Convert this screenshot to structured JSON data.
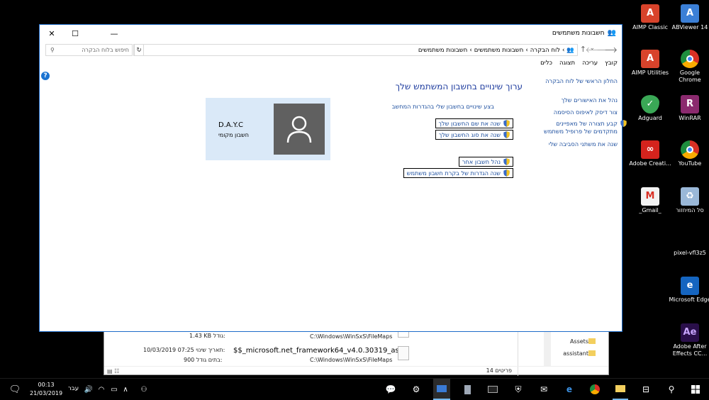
{
  "window": {
    "title": "חשבונות משתמשים",
    "minimize": "—",
    "maximize": "☐",
    "close": "✕"
  },
  "addressbar": {
    "crumbs": [
      "לוח הבקרה",
      "חשבונות משתמשים",
      "חשבונות משתמשים"
    ],
    "search_placeholder": "חיפוש בלוח הבקרה"
  },
  "menu": [
    "קובץ",
    "עריכה",
    "תצוגה",
    "כלים"
  ],
  "left_pane": {
    "home": "החלון הראשי של לוח הבקרה",
    "links": [
      "נהל את האישורים שלך",
      "צור דיסק לאיפוס הסיסמה",
      "קבע תצורה של מאפיינים",
      "מתקדמים של פרופיל משתמש",
      "שנה את משתני הסביבה שלי"
    ]
  },
  "main": {
    "heading": "ערוך שינויים בחשבון המשתמש שלך",
    "pc_settings_link": "בצע שינויים בחשבון שלי בהגדרות המחשב",
    "tasks": [
      "שנה את שם החשבון שלך",
      "שנה את סוג החשבון שלך",
      "נהל חשבון אחר",
      "שנה הגדרות של בקרת חשבון משתמש"
    ]
  },
  "user": {
    "name": "D.A.Y.C",
    "type": "חשבון מקומי"
  },
  "explorer": {
    "file_size_label": "גודל:",
    "file_size_top": "1.43 KB",
    "path_top": "C:\\Windows\\WinSxS\\FileMaps",
    "file_name": "$$_microsoft.net_framework64_v4.0.30319_as...",
    "modified_label": "תאריך שינוי:",
    "modified_value": "10/03/2019 07:25",
    "size_label": "גודל:",
    "size_value": "900 בתים",
    "path": "C:\\Windows\\WinSxS\\FileMaps",
    "nav_items": [
      "Assets",
      "assistant"
    ],
    "item_count": "14 פריטים"
  },
  "desktop_icons": [
    {
      "label": "AIMP Classic",
      "icon": "aimp-icon",
      "color": "#d8432b"
    },
    {
      "label": "ABViewer 14",
      "icon": "abviewer-icon",
      "color": "#3b7fd6"
    },
    {
      "label": "AIMP Utilities",
      "icon": "aimp-icon",
      "color": "#d8432b"
    },
    {
      "label": "Google Chrome",
      "icon": "chrome-icon",
      "color": "#2f9e44"
    },
    {
      "label": "Adguard",
      "icon": "adguard-icon",
      "color": "#3aa856"
    },
    {
      "label": "WinRAR",
      "icon": "winrar-icon",
      "color": "#8b2a6e"
    },
    {
      "label": "Adobe Creati...",
      "icon": "adobe-cc-icon",
      "color": "#d4231d"
    },
    {
      "label": "YouTube",
      "icon": "chrome-icon",
      "color": "#2f9e44"
    },
    {
      "label": "_Gmail_",
      "icon": "gmail-icon",
      "color": "#e8e8e8"
    },
    {
      "label": "סל המיחזור",
      "icon": "recycle-bin-icon",
      "color": "#9ab8d8"
    },
    {
      "label": "pixel-vfl3z5",
      "icon": "",
      "color": ""
    },
    {
      "label": "Microsoft Edge",
      "icon": "edge-icon",
      "color": "#1565c0"
    },
    {
      "label": "Adobe After Effects CC...",
      "icon": "after-effects-icon",
      "color": "#2a0f4a"
    }
  ],
  "taskbar": {
    "time": "00:13",
    "date": "21/03/2019",
    "language": "עבר"
  }
}
